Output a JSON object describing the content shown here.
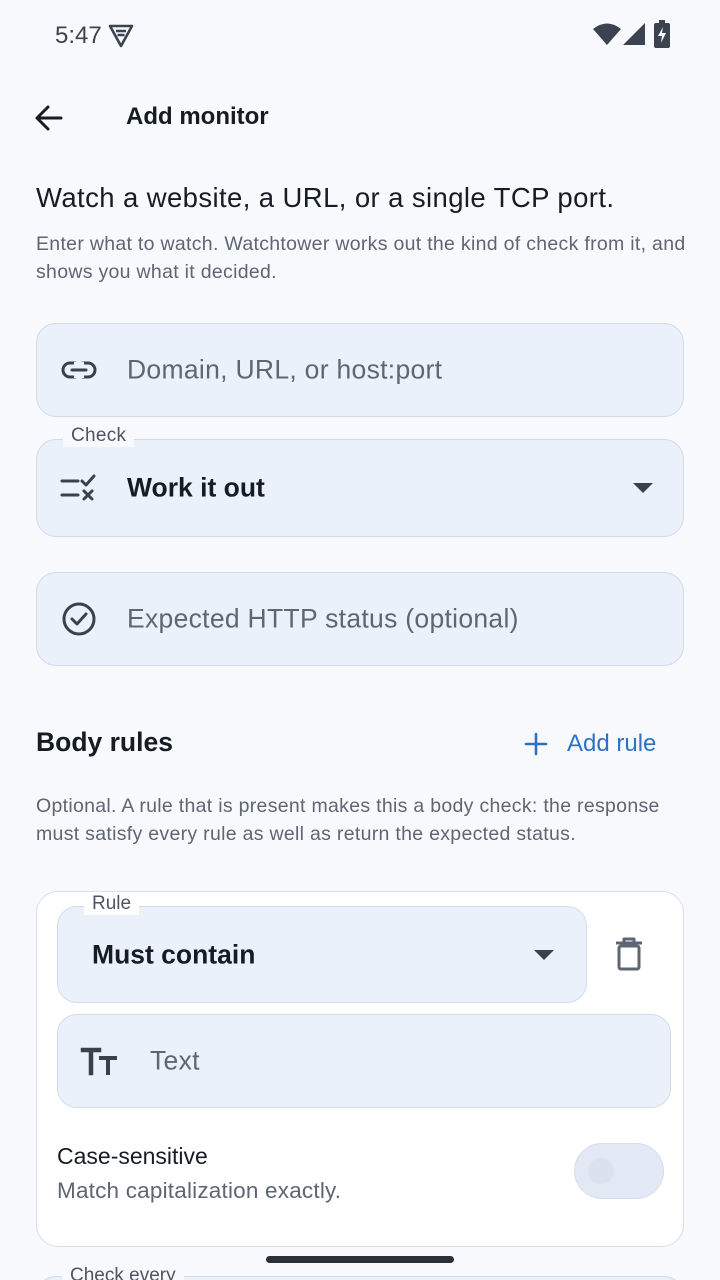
{
  "status_bar": {
    "time": "5:47"
  },
  "app_bar": {
    "title": "Add monitor",
    "back_icon": "arrow-left-icon"
  },
  "intro": {
    "headline": "Watch a website, a URL, or a single TCP port.",
    "description": "Enter what to watch. Watchtower works out the kind of check from it, and shows you what it decided."
  },
  "url_field": {
    "placeholder": "Domain, URL, or host:port",
    "icon": "link-icon"
  },
  "check_field": {
    "label": "Check",
    "value": "Work it out",
    "icon": "checklist-icon"
  },
  "status_field": {
    "placeholder": "Expected HTTP status (optional)",
    "icon": "check-circle-icon"
  },
  "body_rules": {
    "title": "Body rules",
    "add_label": "Add rule",
    "description": "Optional. A rule that is present makes this a body check: the response must satisfy every rule as well as return the expected status.",
    "rule": {
      "type_label": "Rule",
      "type_value": "Must contain",
      "text_placeholder": "Text",
      "case_title": "Case-sensitive",
      "case_subtitle": "Match capitalization exactly.",
      "case_sensitive": false
    }
  },
  "next_field": {
    "label": "Check every"
  },
  "colors": {
    "accent": "#2f72c4",
    "field_bg": "#ebf1fb",
    "background": "#f8f9fd"
  }
}
